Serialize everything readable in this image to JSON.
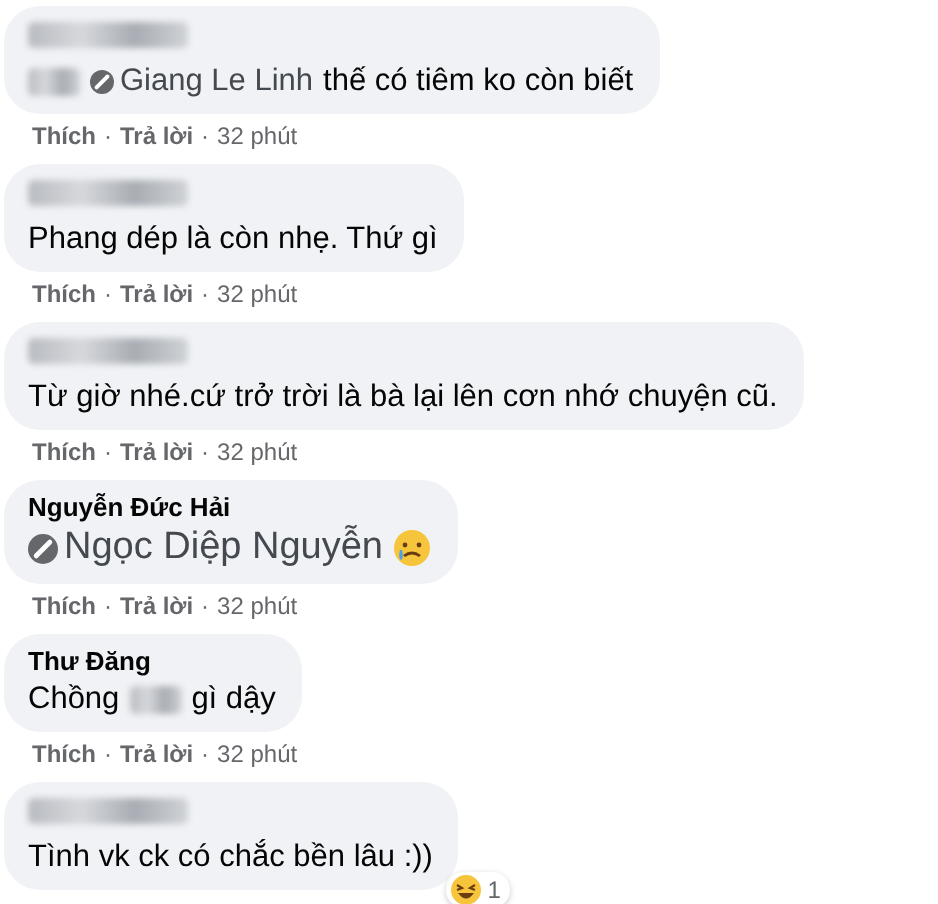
{
  "comments": [
    {
      "author": {
        "kind": "blurred"
      },
      "jumbo": false,
      "message": [
        {
          "kind": "blurred"
        },
        {
          "kind": "mention",
          "text": "Giang Le Linh"
        },
        {
          "kind": "text",
          "text": "thế có tiêm ko còn biết"
        }
      ],
      "footer": [
        {
          "kind": "link",
          "text": "Thích"
        },
        {
          "kind": "sep",
          "text": "·"
        },
        {
          "kind": "link",
          "text": "Trả lời"
        },
        {
          "kind": "sep",
          "text": "·"
        },
        {
          "kind": "time",
          "text": "32 phút"
        }
      ]
    },
    {
      "author": {
        "kind": "blurred"
      },
      "jumbo": false,
      "message": [
        {
          "kind": "text",
          "text": "Phang dép là còn nhẹ. Thứ gì"
        }
      ],
      "footer": [
        {
          "kind": "link",
          "text": "Thích"
        },
        {
          "kind": "sep",
          "text": "·"
        },
        {
          "kind": "link",
          "text": "Trả lời"
        },
        {
          "kind": "sep",
          "text": "·"
        },
        {
          "kind": "time",
          "text": "32 phút"
        }
      ]
    },
    {
      "author": {
        "kind": "blurred"
      },
      "jumbo": false,
      "message": [
        {
          "kind": "text",
          "text": "Từ giờ nhé.cứ trở trời là bà lại lên cơn nhớ chuyện cũ."
        }
      ],
      "footer": [
        {
          "kind": "link",
          "text": "Thích"
        },
        {
          "kind": "sep",
          "text": "·"
        },
        {
          "kind": "link",
          "text": "Trả lời"
        },
        {
          "kind": "sep",
          "text": "·"
        },
        {
          "kind": "time",
          "text": "32 phút"
        }
      ]
    },
    {
      "author": {
        "kind": "name",
        "text": "Nguyễn Đức Hải"
      },
      "jumbo": true,
      "message": [
        {
          "kind": "mention",
          "text": "Ngọc Diệp Nguyễn"
        },
        {
          "kind": "emoji"
        }
      ],
      "footer": [
        {
          "kind": "link",
          "text": "Thích"
        },
        {
          "kind": "sep",
          "text": "·"
        },
        {
          "kind": "link",
          "text": "Trả lời"
        },
        {
          "kind": "sep",
          "text": "·"
        },
        {
          "kind": "time",
          "text": "32 phút"
        }
      ]
    },
    {
      "author": {
        "kind": "name",
        "text": "Thư Đăng"
      },
      "jumbo": false,
      "message": [
        {
          "kind": "text",
          "text": "Chồng"
        },
        {
          "kind": "blurred"
        },
        {
          "kind": "text",
          "text": "gì dậy"
        }
      ],
      "footer": [
        {
          "kind": "link",
          "text": "Thích"
        },
        {
          "kind": "sep",
          "text": "·"
        },
        {
          "kind": "link",
          "text": "Trả lời"
        },
        {
          "kind": "sep",
          "text": "·"
        },
        {
          "kind": "time",
          "text": "32 phút"
        }
      ]
    },
    {
      "author": {
        "kind": "blurred"
      },
      "jumbo": false,
      "message": [
        {
          "kind": "text",
          "text": "Tình vk ck có chắc bền lâu :))"
        }
      ],
      "reaction": {
        "count": "1"
      }
    }
  ]
}
